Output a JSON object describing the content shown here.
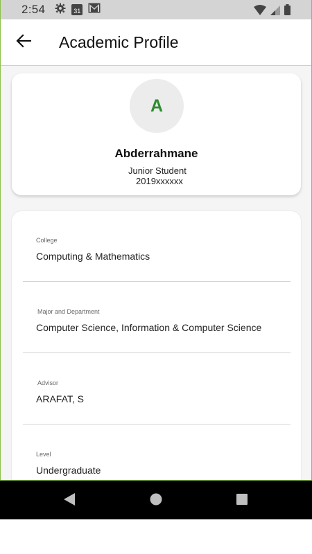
{
  "status_bar": {
    "time": "2:54",
    "left_icons": [
      "gear-icon",
      "calendar-icon",
      "gmail-icon"
    ],
    "calendar_day": "31",
    "right_icons": [
      "wifi-icon",
      "signal-icon",
      "battery-icon"
    ]
  },
  "app_bar": {
    "title": "Academic Profile",
    "back_icon": "arrow-back-icon"
  },
  "profile": {
    "avatar_initial": "A",
    "name": "Abderrahmane",
    "status": "Junior Student",
    "student_id": "2019xxxxxx",
    "accent_color": "#2e8b2e"
  },
  "details": {
    "college": {
      "label": "College",
      "value": "Computing & Mathematics"
    },
    "major": {
      "label": "Major and Department",
      "value": "Computer Science, Information & Computer Science"
    },
    "advisor": {
      "label": "Advisor",
      "value": "ARAFAT, S"
    },
    "level": {
      "label": "Level",
      "value": "Undergraduate"
    }
  },
  "nav_bar": {
    "icons": [
      "back-triangle-icon",
      "home-circle-icon",
      "recents-square-icon"
    ]
  }
}
